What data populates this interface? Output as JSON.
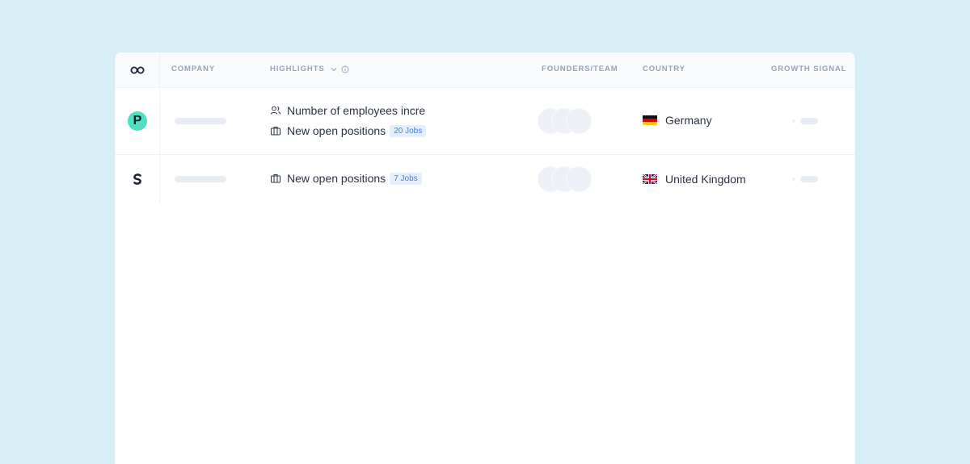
{
  "columns": {
    "company": "COMPANY",
    "highlights": "HIGHLIGHTS",
    "founders_team": "FOUNDERS/TEAM",
    "country": "COUNTRY",
    "growth_signal": "GROWTH SIGNAL"
  },
  "rows": [
    {
      "logo_letter": "P",
      "logo_color": "#4fe0c0",
      "highlights": [
        {
          "icon": "people-icon",
          "text": "Number of employees incre",
          "badge": ""
        },
        {
          "icon": "briefcase-icon",
          "text": "New open positions",
          "badge": "20 Jobs"
        }
      ],
      "country": "Germany",
      "flag": "germany-flag-icon"
    },
    {
      "logo_icon": "s-logo-icon",
      "highlights": [
        {
          "icon": "briefcase-icon",
          "text": "New open positions",
          "badge": "7 Jobs"
        }
      ],
      "country": "United Kingdom",
      "flag": "uk-flag-icon"
    }
  ],
  "colors": {
    "background": "#d8eef6",
    "badge_bg": "#e4eefc",
    "badge_text": "#4a7fd0"
  }
}
